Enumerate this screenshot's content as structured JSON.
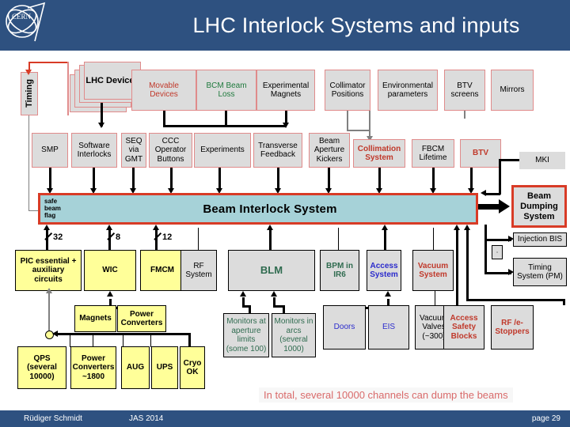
{
  "header": {
    "title": "LHC Interlock Systems and inputs",
    "logo": "cern-logo"
  },
  "footer": {
    "author": "Rüdiger Schmidt",
    "conference": "JAS 2014",
    "page": "page 29"
  },
  "summary_note": "In total, several 10000 channels can dump the beams",
  "labels": {
    "timing": "Timing",
    "lhc_devices": "LHC Devices",
    "safe_beam_flag": "safe beam flag",
    "bis_title": "Beam Interlock System",
    "beam_dumping_system": "Beam Dumping System",
    "count_32": "32",
    "count_8": "8",
    "count_12": "12"
  },
  "row_inputs_top": [
    {
      "label": "Movable Devices",
      "color": "#c0392b"
    },
    {
      "label": "BCM Beam Loss",
      "color": "#1f7a3d"
    },
    {
      "label": "Experimental Magnets",
      "color": "#000000"
    },
    {
      "label": "Collimator Positions",
      "color": "#000000"
    },
    {
      "label": "Environmental parameters",
      "color": "#000000"
    },
    {
      "label": "BTV screens",
      "color": "#000000"
    },
    {
      "label": "Mirrors",
      "color": "#000000"
    }
  ],
  "row_clients": [
    {
      "label": "SMP",
      "color": "#000000"
    },
    {
      "label": "Software Interlocks",
      "color": "#000000"
    },
    {
      "label": "SEQ via GMT",
      "color": "#000000"
    },
    {
      "label": "CCC Operator Buttons",
      "color": "#000000"
    },
    {
      "label": "Experiments",
      "color": "#000000"
    },
    {
      "label": "Transverse Feedback",
      "color": "#000000"
    },
    {
      "label": "Beam Aperture Kickers",
      "color": "#000000"
    },
    {
      "label": "Collimation System",
      "color": "#c0392b"
    },
    {
      "label": "FBCM Lifetime",
      "color": "#000000"
    },
    {
      "label": "BTV",
      "color": "#c0392b"
    },
    {
      "label": "MKI",
      "color": "#000000"
    }
  ],
  "row_systems": [
    {
      "label": "PIC essential + auxiliary circuits",
      "color": "#000000",
      "fill": "yellow"
    },
    {
      "label": "WIC",
      "color": "#000000",
      "fill": "yellow"
    },
    {
      "label": "FMCM",
      "color": "#000000",
      "fill": "yellow"
    },
    {
      "label": "RF System",
      "color": "#000000",
      "fill": "grey"
    },
    {
      "label": "BLM",
      "color": "#2f6b4f",
      "fill": "grey"
    },
    {
      "label": "BPM in IR6",
      "color": "#2f6b4f",
      "fill": "grey"
    },
    {
      "label": "Access System",
      "color": "#2b2bcc",
      "fill": "grey"
    },
    {
      "label": "Vacuum System",
      "color": "#c0392b",
      "fill": "grey"
    }
  ],
  "row_sources": [
    {
      "label": "Magnets",
      "color": "#000000",
      "fill": "yellow"
    },
    {
      "label": "Power Converters",
      "color": "#000000",
      "fill": "yellow"
    },
    {
      "label": "Monitors at aperture limits (some 100)",
      "color": "#2f6b4f",
      "fill": "grey"
    },
    {
      "label": "Monitors in arcs (several 1000)",
      "color": "#2f6b4f",
      "fill": "grey"
    },
    {
      "label": "Doors",
      "color": "#2b2bcc",
      "fill": "grey"
    },
    {
      "label": "EIS",
      "color": "#2b2bcc",
      "fill": "grey"
    },
    {
      "label": "Vacuum Valves (~300)",
      "color": "#000000",
      "fill": "grey"
    }
  ],
  "row_bottom": [
    {
      "label": "QPS (several 10000)",
      "color": "#000000",
      "fill": "yellow"
    },
    {
      "label": "Power Converters ~1800",
      "color": "#000000",
      "fill": "yellow"
    },
    {
      "label": "AUG",
      "color": "#000000",
      "fill": "yellow"
    },
    {
      "label": "UPS",
      "color": "#000000",
      "fill": "yellow"
    },
    {
      "label": "Cryo OK",
      "color": "#000000",
      "fill": "yellow"
    },
    {
      "label": "Access Safety Blocks",
      "color": "#c0392b",
      "fill": "grey"
    },
    {
      "label": "RF /e-Stoppers",
      "color": "#c0392b",
      "fill": "grey"
    }
  ],
  "right_outputs": [
    {
      "label": "Injection BIS",
      "color": "#000000"
    },
    {
      "label": "Timing System (PM)",
      "color": "#000000"
    }
  ],
  "colors": {
    "header_bg": "#2e5180",
    "bis_fill": "#a6d2d8",
    "bis_border": "#d83b26",
    "box_grey": "#dcdcdc",
    "box_yellow": "#ffff99",
    "red_border": "#e08b8b",
    "note_red": "#d96a6a"
  }
}
